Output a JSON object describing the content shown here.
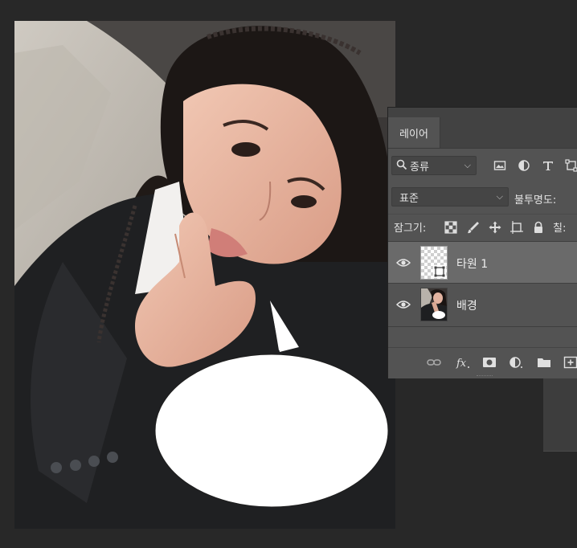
{
  "layers_panel": {
    "tab_label": "레이어",
    "filter": {
      "value": "종류",
      "icons": [
        "image-filter-icon",
        "adjustment-filter-icon",
        "type-filter-icon",
        "shape-filter-icon"
      ]
    },
    "blend_mode": "표준",
    "opacity_label": "불투명도:",
    "lock_label": "잠그기:",
    "fill_label": "칠:",
    "layers": [
      {
        "name": "타원 1",
        "selected": true,
        "visible": true,
        "type": "shape"
      },
      {
        "name": "배경",
        "selected": false,
        "visible": true,
        "type": "image"
      }
    ],
    "footer_icons": [
      "link-layers-icon",
      "fx-icon",
      "add-mask-icon",
      "adjustment-layer-icon",
      "group-folder-icon",
      "new-layer-icon"
    ]
  },
  "canvas": {
    "content": "photo with white speech bubble",
    "bubble_color": "#ffffff"
  },
  "colors": {
    "workspace": "#282828",
    "panel": "#535353",
    "selected_layer": "#6a6a6a"
  }
}
